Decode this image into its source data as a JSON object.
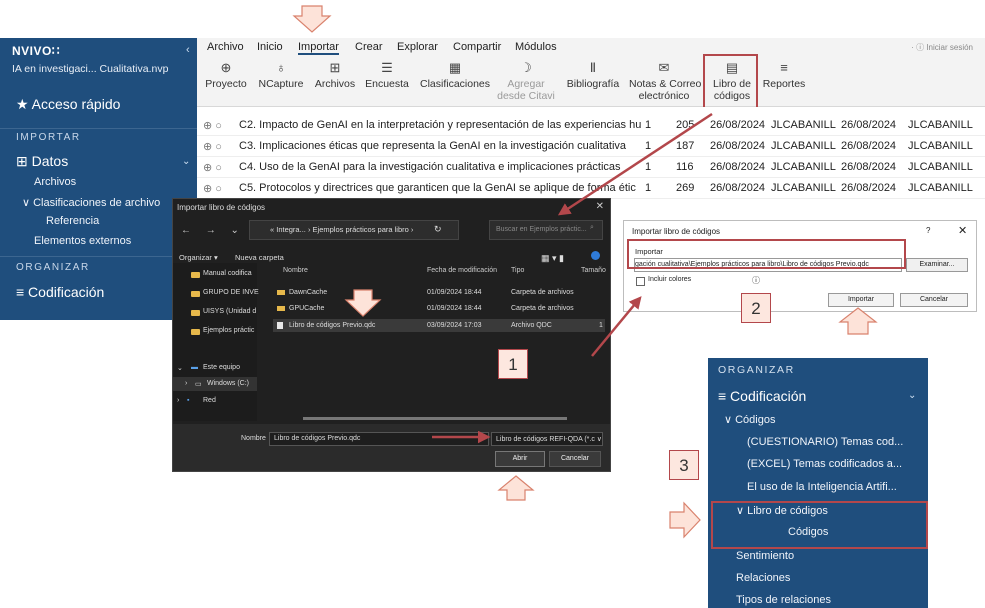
{
  "sidebar": {
    "brand": "NVIVO∷",
    "project": "IA en investigaci... Cualitativa.nvp",
    "quick_access": "★ Acceso rápido",
    "importar_heading": "IMPORTAR",
    "datos": "⊞ Datos",
    "archivos": "Archivos",
    "clasificaciones": "∨ Clasificaciones de archivo",
    "referencia": "Referencia",
    "elementos_externos": "Elementos externos",
    "organizar_heading": "ORGANIZAR",
    "codificacion": "≡ Codificación"
  },
  "menubar": {
    "items": [
      "Archivo",
      "Inicio",
      "Importar",
      "Crear",
      "Explorar",
      "Compartir",
      "Módulos"
    ],
    "active": "Importar",
    "signin": "· ⓘ Iniciar sesión"
  },
  "ribbon": [
    {
      "label": "Proyecto",
      "label2": "",
      "icon": "⊕"
    },
    {
      "label": "NCapture",
      "label2": "",
      "icon": "♁"
    },
    {
      "label": "Archivos",
      "label2": "",
      "icon": "⊞"
    },
    {
      "label": "Encuesta",
      "label2": "",
      "icon": "☰"
    },
    {
      "label": "Clasificaciones",
      "label2": "",
      "icon": "▦"
    },
    {
      "label": "Agregar",
      "label2": "desde Citavi",
      "icon": "☽"
    },
    {
      "label": "Bibliografía",
      "label2": "",
      "icon": "Ⅱ"
    },
    {
      "label": "Notas & Correo",
      "label2": "electrónico",
      "icon": "✉"
    },
    {
      "label": "Libro de",
      "label2": "códigos",
      "icon": "▤"
    },
    {
      "label": "Reportes",
      "label2": "",
      "icon": "≡"
    }
  ],
  "table": {
    "rows": [
      {
        "name": "C2. Impacto de GenAI en la interpretación y representación de las experiencias hu",
        "files": "1",
        "refs": "205",
        "created": "26/08/2024",
        "by": "JLCABANILL",
        "modified": "26/08/2024",
        "mby": "JLCABANILL"
      },
      {
        "name": "C3. Implicaciones éticas que representa la GenAI en la investigación cualitativa",
        "files": "1",
        "refs": "187",
        "created": "26/08/2024",
        "by": "JLCABANILL",
        "modified": "26/08/2024",
        "mby": "JLCABANILL"
      },
      {
        "name": "C4. Uso de la GenAI para la investigación cualitativa e implicaciones prácticas",
        "files": "1",
        "refs": "116",
        "created": "26/08/2024",
        "by": "JLCABANILL",
        "modified": "26/08/2024",
        "mby": "JLCABANILL"
      },
      {
        "name": "C5. Protocolos y directrices que garanticen que la GenAI se aplique de forma étic",
        "files": "1",
        "refs": "269",
        "created": "26/08/2024",
        "by": "JLCABANILL",
        "modified": "26/08/2024",
        "mby": "JLCABANILL"
      }
    ]
  },
  "filedlg": {
    "title": "Importar libro de códigos",
    "address": "« Integra... › Ejemplos prácticos para libro ›",
    "search_placeholder": "Buscar en Ejemplos práctic...",
    "organize": "Organizar ▾",
    "new_folder": "Nueva carpeta",
    "nav": [
      "Manual codifica",
      "GRUPO DE INVE",
      "UISYS (Unidad d",
      "Ejemplos práctic"
    ],
    "nav2": [
      "Este equipo",
      "Windows (C:)",
      "Red"
    ],
    "headers": {
      "name": "Nombre",
      "date": "Fecha de modificación",
      "type": "Tipo",
      "size": "Tamaño"
    },
    "files": [
      {
        "name": "DawnCache",
        "date": "01/09/2024 18:44",
        "type": "Carpeta de archivos",
        "size": ""
      },
      {
        "name": "GPUCache",
        "date": "01/09/2024 18:44",
        "type": "Carpeta de archivos",
        "size": ""
      },
      {
        "name": "Libro de códigos Previo.qdc",
        "date": "03/09/2024 17:03",
        "type": "Archivo QDC",
        "size": "1"
      }
    ],
    "filename_label": "Nombre",
    "filename": "Libro de códigos Previo.qdc",
    "filetype": "Libro de códigos REFI-QDA (*.c ∨",
    "open": "Abrir",
    "cancel": "Cancelar"
  },
  "impdlg": {
    "title": "Importar libro de códigos",
    "help": "?",
    "close": "✕",
    "label": "Importar",
    "path": "gación cualitativa\\Ejemplos prácticos para libro\\Libro de códigos Previo.qdc",
    "browse": "Examinar...",
    "include_colors": "Incluir colores",
    "info": "ⓘ",
    "import": "Importar",
    "cancel": "Cancelar"
  },
  "orgpanel": {
    "heading": "ORGANIZAR",
    "codificacion": "≡ Codificación",
    "codigos": "∨ Códigos",
    "items": [
      "(CUESTIONARIO) Temas cod...",
      "(EXCEL) Temas codificados a...",
      "El uso de la Inteligencia Artifi..."
    ],
    "libro": "∨ Libro de códigos",
    "libro_child": "Códigos",
    "sentimiento": "Sentimiento",
    "relaciones": "Relaciones",
    "tipos": "Tipos de relaciones"
  },
  "steps": [
    "1",
    "2",
    "3"
  ],
  "colors": {
    "nvivo_blue": "#1f4e7d",
    "annotation_red": "#b3474b",
    "arrow_fill": "#fde3d9"
  }
}
